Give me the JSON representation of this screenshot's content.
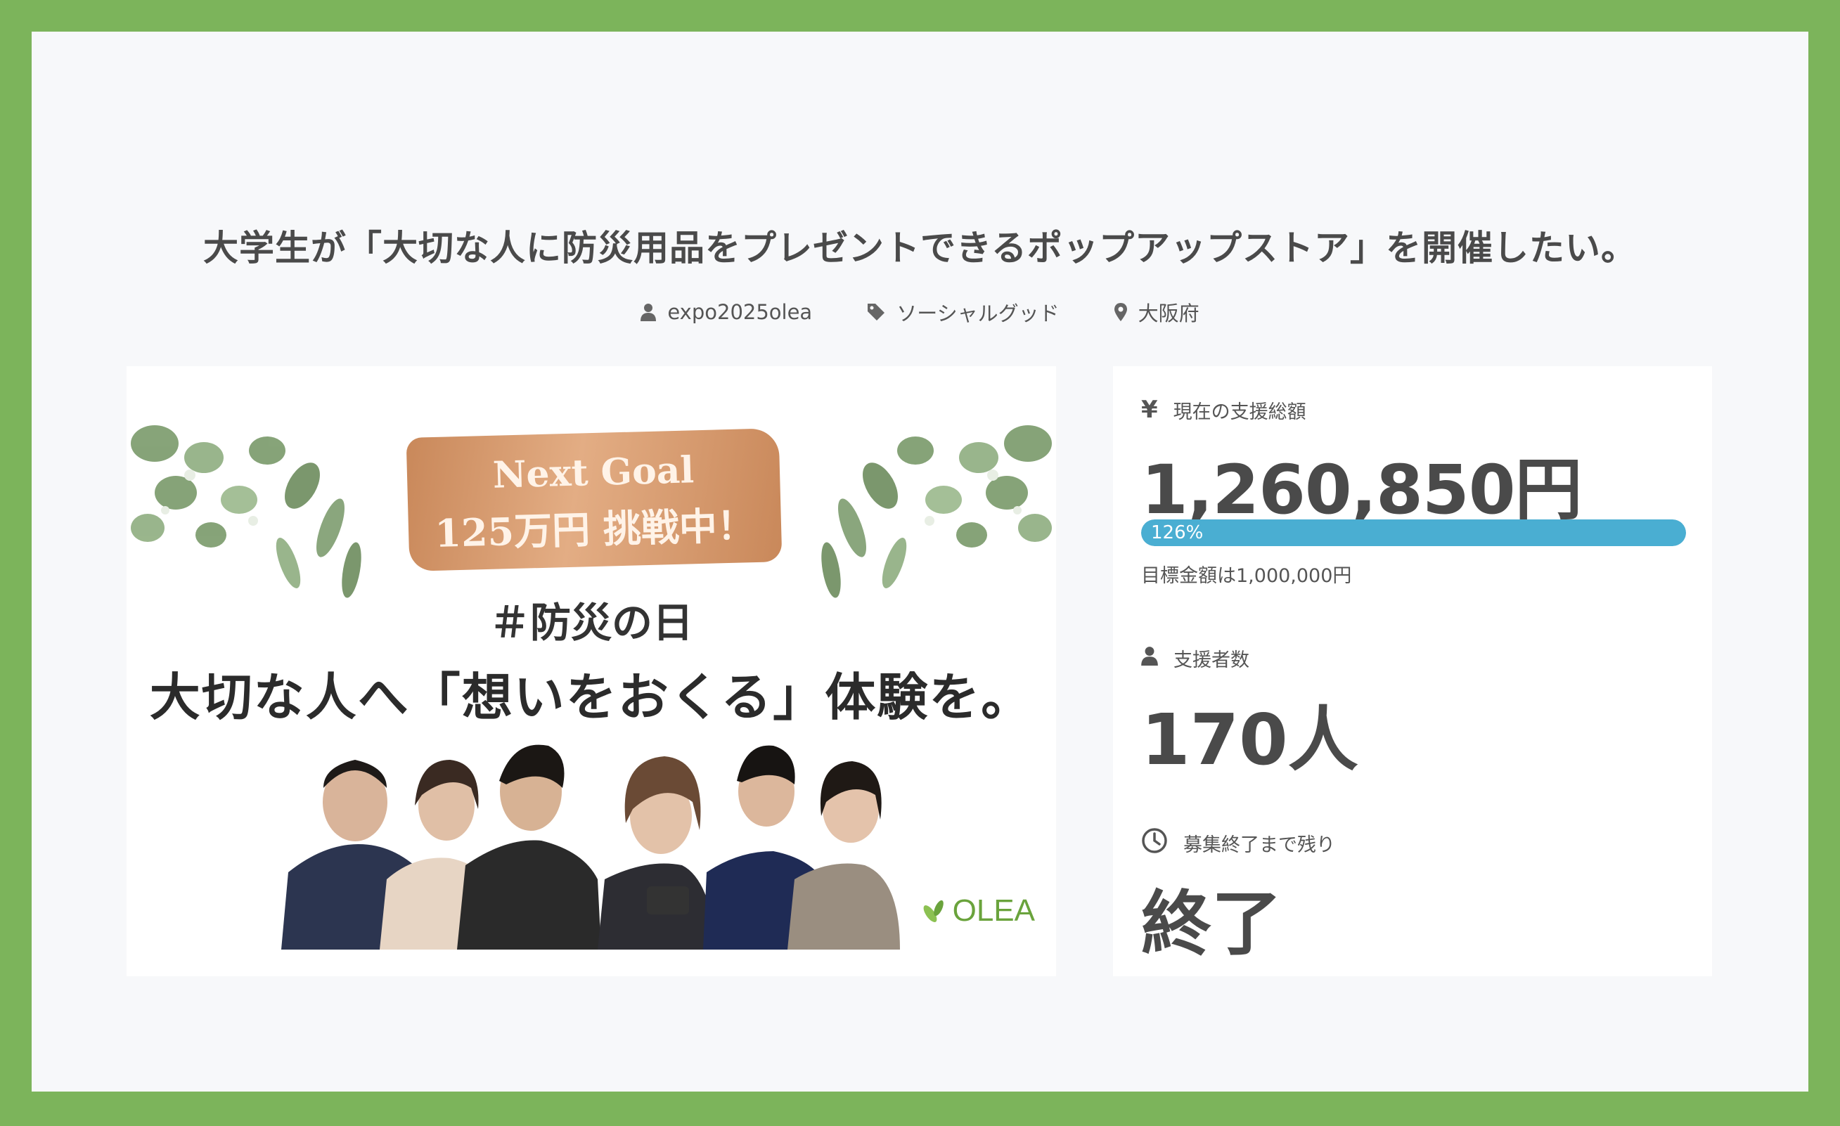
{
  "project": {
    "title": "大学生が「大切な人に防災用品をプレゼントできるポップアップストア」を開催したい。",
    "owner": "expo2025olea",
    "category": "ソーシャルグッド",
    "location": "大阪府"
  },
  "hero_image": {
    "goal_line1": "Next Goal",
    "goal_line2": "125万円 挑戦中！",
    "hashtag": "＃防災の日",
    "headline": "大切な人へ「想いをおくる」体験を。",
    "brand": "OLEA"
  },
  "stats": {
    "amount_label": "現在の支援総額",
    "amount_value": "1,260,850円",
    "progress_text": "126%",
    "progress_fraction": 1.0,
    "goal_text": "目標金額は1,000,000円",
    "supporters_label": "支援者数",
    "supporters_value": "170人",
    "remaining_label": "募集終了まで残り",
    "remaining_value": "終了",
    "progress_color": "#4aaed2"
  },
  "colors": {
    "frame": "#7cb45b",
    "page_bg": "#f7f8fa",
    "brand_green": "#6aa33c"
  }
}
